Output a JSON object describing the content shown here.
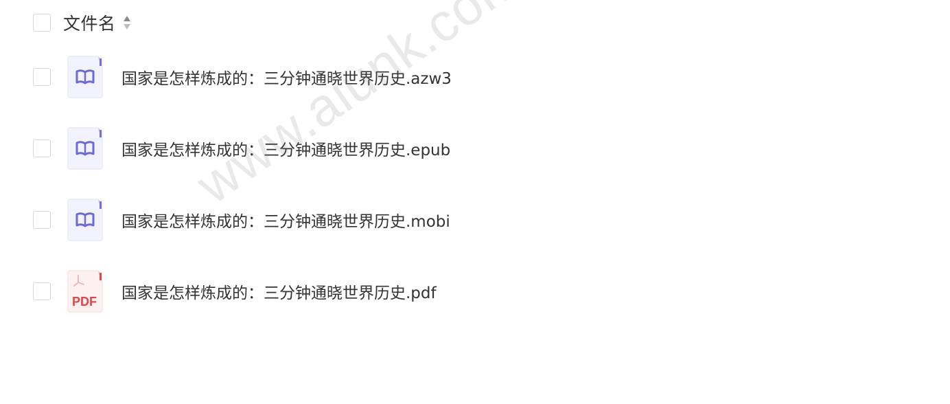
{
  "header": {
    "column_label": "文件名",
    "sort_icon": "sort-icon"
  },
  "files": [
    {
      "name": "国家是怎样炼成的：三分钟通晓世界历史.azw3",
      "icon": "ebook-icon"
    },
    {
      "name": "国家是怎样炼成的：三分钟通晓世界历史.epub",
      "icon": "ebook-icon"
    },
    {
      "name": "国家是怎样炼成的：三分钟通晓世界历史.mobi",
      "icon": "ebook-icon"
    },
    {
      "name": "国家是怎样炼成的：三分钟通晓世界历史.pdf",
      "icon": "pdf-icon"
    }
  ],
  "pdf_icon_label": "PDF",
  "watermark": "www.aiunk.com",
  "colors": {
    "ebook_accent": "#6b6bd6",
    "ebook_bg": "#f2f2fd",
    "pdf_accent": "#e04646",
    "pdf_bg": "#fdf0f0",
    "text": "#333333"
  }
}
